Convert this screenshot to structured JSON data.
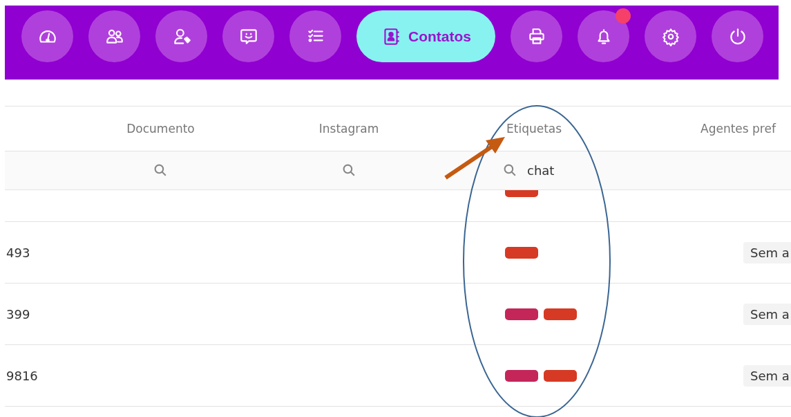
{
  "nav": [
    {
      "kind": "dashboard",
      "selected": false,
      "badge": false
    },
    {
      "kind": "users",
      "selected": false,
      "badge": false
    },
    {
      "kind": "user-tag",
      "selected": false,
      "badge": false
    },
    {
      "kind": "chat",
      "selected": false,
      "badge": false
    },
    {
      "kind": "tasks",
      "selected": false,
      "badge": false
    },
    {
      "kind": "contacts",
      "label": "Contatos",
      "selected": true,
      "badge": false
    },
    {
      "kind": "printer",
      "selected": false,
      "badge": false
    },
    {
      "kind": "bell",
      "selected": false,
      "badge": true
    },
    {
      "kind": "settings",
      "selected": false,
      "badge": false
    },
    {
      "kind": "power",
      "selected": false,
      "badge": false
    }
  ],
  "table": {
    "columns": [
      {
        "label": "Documento",
        "filter": true
      },
      {
        "label": "Instagram",
        "filter": true
      },
      {
        "label": "Etiquetas",
        "filter": true,
        "filter_value": "chat"
      },
      {
        "label": "Agentes pref",
        "filter": false
      }
    ],
    "rows": [
      {
        "tags": [
          {
            "color": "#d63a24"
          }
        ]
      },
      {
        "column_1": "493",
        "tags": [
          {
            "color": "#d63a24"
          }
        ],
        "agent": "Sem a"
      },
      {
        "column_1": "399",
        "tags": [
          {
            "color": "#c4265a"
          },
          {
            "color": "#d63a24"
          }
        ],
        "agent": "Sem a"
      },
      {
        "column_1": "9816",
        "tags": [
          {
            "color": "#c4265a"
          },
          {
            "color": "#d63a24"
          }
        ],
        "agent": "Sem a"
      }
    ]
  }
}
